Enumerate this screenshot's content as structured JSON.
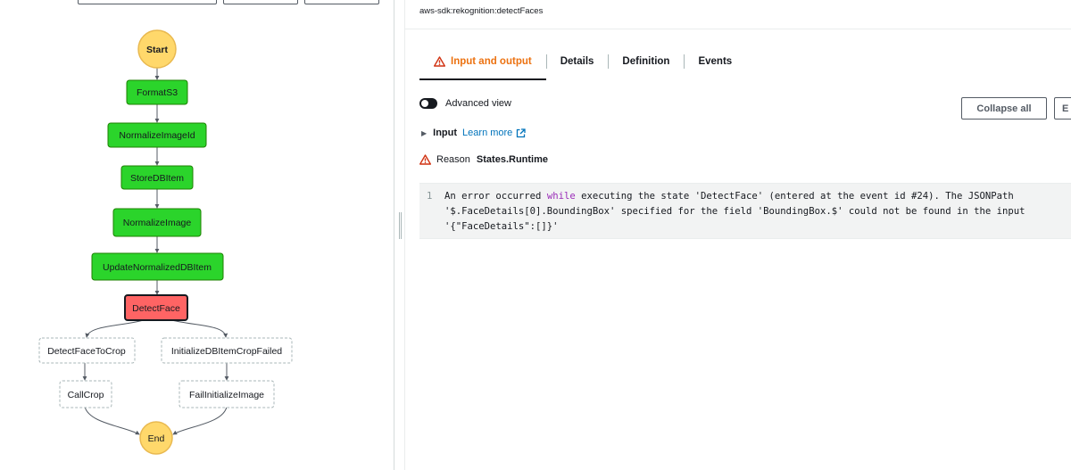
{
  "colors": {
    "success": "#2bd42b",
    "success_border": "#1d8102",
    "failed": "#ff6464",
    "failed_border": "#16191f",
    "terminal": "#ffd86b",
    "terminal_border": "#e9b950",
    "warning": "#d13212",
    "tab_active": "#ec7211",
    "link": "#0073bb"
  },
  "graph": {
    "start": "Start",
    "end": "End",
    "nodes": [
      {
        "label": "FormatS3",
        "status": "succeeded"
      },
      {
        "label": "NormalizeImageId",
        "status": "succeeded"
      },
      {
        "label": "StoreDBItem",
        "status": "succeeded"
      },
      {
        "label": "NormalizeImage",
        "status": "succeeded"
      },
      {
        "label": "UpdateNormalizedDBItem",
        "status": "succeeded"
      },
      {
        "label": "DetectFace",
        "status": "failed"
      },
      {
        "label": "DetectFaceToCrop",
        "status": "not-run"
      },
      {
        "label": "InitializeDBItemCropFailed",
        "status": "not-run"
      },
      {
        "label": "CallCrop",
        "status": "not-run"
      },
      {
        "label": "FailInitializeImage",
        "status": "not-run"
      }
    ]
  },
  "details": {
    "resource": "aws-sdk:rekognition:detectFaces",
    "tabs": [
      {
        "label": "Input and output",
        "icon": "warning-icon",
        "active": true
      },
      {
        "label": "Details"
      },
      {
        "label": "Definition"
      },
      {
        "label": "Events"
      }
    ],
    "advanced_view": "Advanced view",
    "collapse_all": "Collapse all",
    "expand_all_partial": "E",
    "input_label": "Input",
    "learn_more": "Learn more",
    "reason_label": "Reason",
    "reason_value": "States.Runtime",
    "code": {
      "line": "1",
      "before_keyword": "An error occurred ",
      "keyword": "while",
      "after_keyword": " executing the state 'DetectFace' (entered at the event id #24). The JSONPath '$.FaceDetails[0].BoundingBox' specified for the field 'BoundingBox.$' could not be found in the input '{\"FaceDetails\":[]}'"
    }
  }
}
